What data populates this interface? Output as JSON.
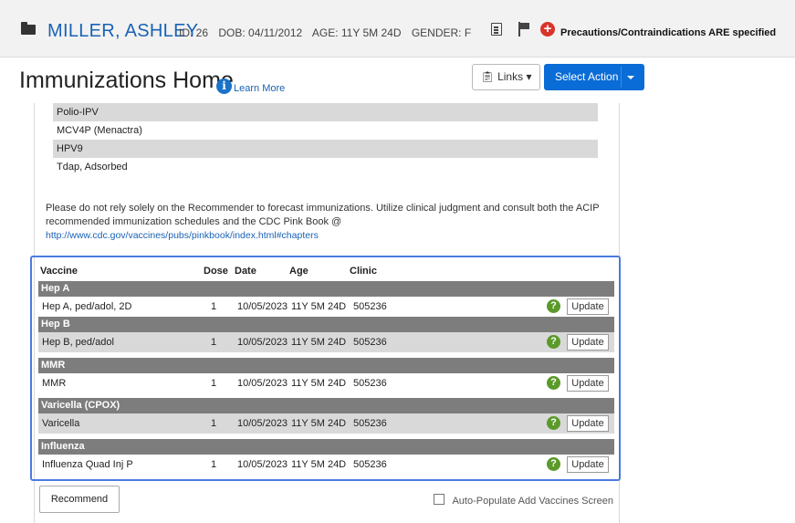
{
  "patient": {
    "name": "MILLER, ASHLEY",
    "id": "ID: 26",
    "dob": "DOB: 04/11/2012",
    "age": "AGE: 11Y 5M 24D",
    "gender": "GENDER: F",
    "precautions": "Precautions/Contraindications ARE specified"
  },
  "page": {
    "title": "Immunizations Home",
    "learn_more": "Learn More",
    "links_label": "Links",
    "action_label": "Select Action"
  },
  "recommended": [
    {
      "name": "Polio-IPV"
    },
    {
      "name": "MCV4P (Menactra)"
    },
    {
      "name": "HPV9"
    },
    {
      "name": "Tdap, Adsorbed"
    }
  ],
  "disclaimer": {
    "text": "Please do not rely solely on the Recommender to forecast immunizations. Utilize clinical judgment and consult both the ACIP recommended immunization schedules and the CDC Pink Book @",
    "link": "http://www.cdc.gov/vaccines/pubs/pinkbook/index.html#chapters"
  },
  "table": {
    "headers": {
      "vaccine": "Vaccine",
      "dose": "Dose",
      "date": "Date",
      "age": "Age",
      "clinic": "Clinic"
    },
    "update_label": "Update",
    "groups": [
      {
        "name": "Hep A",
        "row": {
          "vaccine": "Hep A, ped/adol, 2D",
          "dose": "1",
          "date": "10/05/2023",
          "age": "11Y 5M 24D",
          "clinic": "505236"
        }
      },
      {
        "name": "Hep B",
        "row": {
          "vaccine": "Hep B, ped/adol",
          "dose": "1",
          "date": "10/05/2023",
          "age": "11Y 5M 24D",
          "clinic": "505236"
        }
      },
      {
        "name": "MMR",
        "row": {
          "vaccine": "MMR",
          "dose": "1",
          "date": "10/05/2023",
          "age": "11Y 5M 24D",
          "clinic": "505236"
        }
      },
      {
        "name": "Varicella (CPOX)",
        "row": {
          "vaccine": "Varicella",
          "dose": "1",
          "date": "10/05/2023",
          "age": "11Y 5M 24D",
          "clinic": "505236"
        }
      },
      {
        "name": "Influenza",
        "row": {
          "vaccine": "Influenza Quad Inj P",
          "dose": "1",
          "date": "10/05/2023",
          "age": "11Y 5M 24D",
          "clinic": "505236"
        }
      }
    ]
  },
  "footer": {
    "recommend_label": "Recommend",
    "autopopulate_label": "Auto-Populate Add Vaccines Screen",
    "autopopulate_checked": false
  },
  "icons": [
    "folder-icon",
    "document-icon",
    "flag-icon",
    "plus-circle-icon",
    "info-icon",
    "help-icon"
  ]
}
